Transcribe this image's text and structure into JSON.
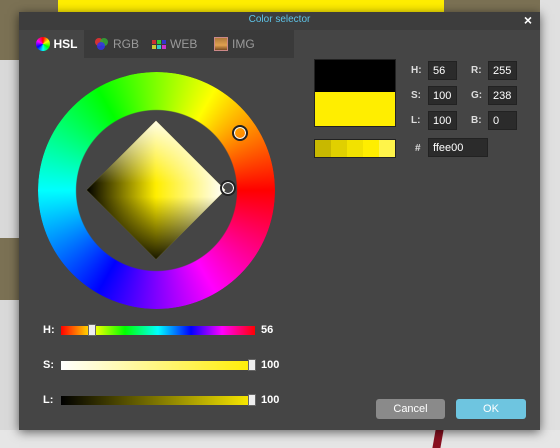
{
  "dialog": {
    "title": "Color selector",
    "close_label": "×"
  },
  "tabs": [
    {
      "label": "HSL",
      "icon": "color-wheel-icon",
      "active": true
    },
    {
      "label": "RGB",
      "icon": "rgb-circles-icon",
      "active": false
    },
    {
      "label": "WEB",
      "icon": "web-grid-icon",
      "active": false
    },
    {
      "label": "IMG",
      "icon": "image-icon",
      "active": false
    }
  ],
  "sliders": {
    "h": {
      "label": "H:",
      "value": "56"
    },
    "s": {
      "label": "S:",
      "value": "100"
    },
    "l": {
      "label": "L:",
      "value": "100"
    }
  },
  "fields": {
    "h": {
      "label": "H:",
      "value": "56"
    },
    "s": {
      "label": "S:",
      "value": "100"
    },
    "l": {
      "label": "L:",
      "value": "100"
    },
    "r": {
      "label": "R:",
      "value": "255"
    },
    "g": {
      "label": "G:",
      "value": "238"
    },
    "b": {
      "label": "B:",
      "value": "0"
    },
    "hex": {
      "label": "#",
      "value": "ffee00"
    }
  },
  "preview": {
    "old_color": "#000000",
    "new_color": "#ffee00"
  },
  "palette": [
    "#c8b800",
    "#e0d000",
    "#f2e200",
    "#ffee00",
    "#fff44a"
  ],
  "buttons": {
    "cancel": "Cancel",
    "ok": "OK"
  },
  "colors": {
    "accent": "#5ec4e8",
    "dialog_bg": "#454545"
  }
}
